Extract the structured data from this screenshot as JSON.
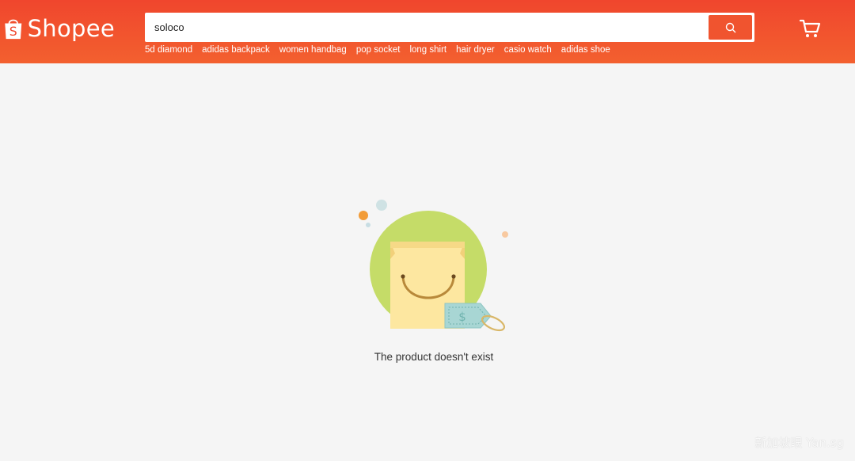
{
  "header": {
    "logo_text": "Shopee",
    "search_value": "soloco",
    "suggestions": [
      "5d diamond",
      "adidas backpack",
      "women handbag",
      "pop socket",
      "long shirt",
      "hair dryer",
      "casio watch",
      "adidas shoe"
    ]
  },
  "main": {
    "empty_message": "The product doesn't exist",
    "illustration_icon": "shopping-bag-with-price-tag"
  },
  "watermark": "新加坡眼 Yan.sg",
  "colors": {
    "brand": "#f0462d",
    "background": "#f5f5f5",
    "illustration_circle": "#c5dc68",
    "bag": "#fde7a0"
  }
}
